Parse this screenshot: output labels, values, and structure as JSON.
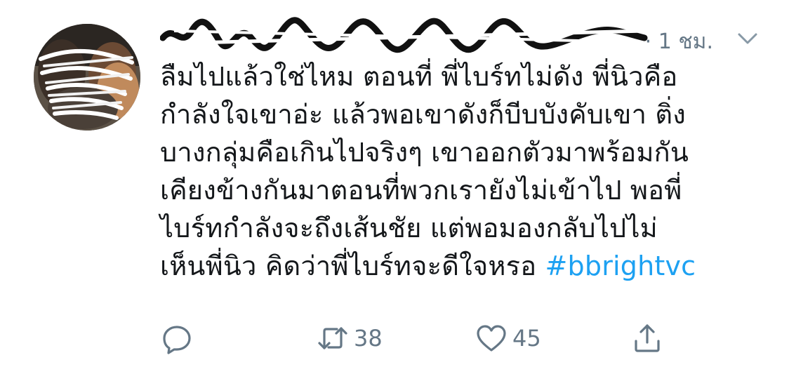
{
  "tweet": {
    "time": "· 1 ชม.",
    "body_lines": [
      "ลืมไปแล้วใช่ไหม ตอนที่ พี่ไบร์ทไม่ดัง พี่นิวคือ",
      "กำลังใจเขาอ่ะ  แล้วพอเขาดังก็บีบบังคับเขา ติ่ง",
      "บางกลุ่มคือเกินไปจริงๆ เขาออกตัวมาพร้อมกัน",
      "เคียงข้างกันมาตอนที่พวกเรายังไม่เข้าไป พอพี่",
      "ไบร์ทกำลังจะถึงเส้นชัย แต่พอมองกลับไปไม่"
    ],
    "last_line_text": "เห็นพี่นิว คิดว่าพี่ไบร์ทจะดีใจหรอ ",
    "hashtag": "#bbrightvc",
    "retweet_count": "38",
    "like_count": "45",
    "colors": {
      "hashtag": "#1da1f2",
      "meta": "#657786",
      "text": "#14171a"
    },
    "icons": {
      "reply": "reply-icon",
      "retweet": "retweet-icon",
      "like": "heart-icon",
      "share": "share-icon",
      "menu": "chevron-down-icon"
    }
  }
}
